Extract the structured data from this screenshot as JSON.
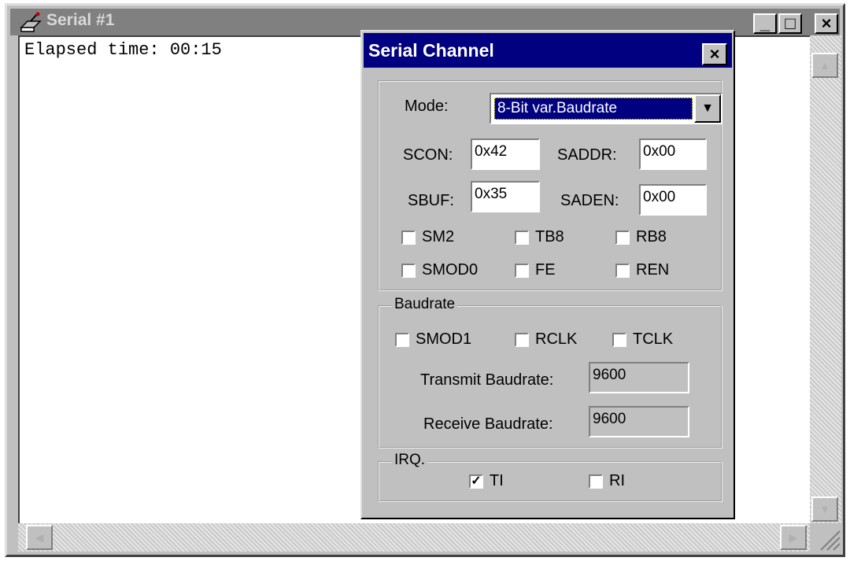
{
  "window": {
    "title": "Serial #1",
    "minimize_glyph": "_",
    "maximize_glyph": "□",
    "close_glyph": "×",
    "content_text": "Elapsed time: 00:15"
  },
  "dialog": {
    "title": "Serial Channel",
    "close_glyph": "×",
    "mode_label": "Mode:",
    "mode_value": "8-Bit var.Baudrate",
    "scon_label": "SCON:",
    "scon_value": "0x42",
    "saddr_label": "SADDR:",
    "saddr_value": "0x00",
    "sbuf_label": "SBUF:",
    "sbuf_value": "0x35",
    "saden_label": "SADEN:",
    "saden_value": "0x00",
    "flags": [
      {
        "label": "SM2",
        "checked": false
      },
      {
        "label": "TB8",
        "checked": false
      },
      {
        "label": "RB8",
        "checked": false
      },
      {
        "label": "SMOD0",
        "checked": false
      },
      {
        "label": "FE",
        "checked": false
      },
      {
        "label": "REN",
        "checked": false
      }
    ],
    "baudrate": {
      "group_label": "Baudrate",
      "flags": [
        {
          "label": "SMOD1",
          "checked": false
        },
        {
          "label": "RCLK",
          "checked": false
        },
        {
          "label": "TCLK",
          "checked": false
        }
      ],
      "transmit_label": "Transmit Baudrate:",
      "transmit_value": "9600",
      "receive_label": "Receive Baudrate:",
      "receive_value": "9600"
    },
    "irq": {
      "group_label": "IRQ.",
      "flags": [
        {
          "label": "TI",
          "checked": true
        },
        {
          "label": "RI",
          "checked": false
        }
      ]
    }
  },
  "icons": {
    "window_icon": "serial-port-icon",
    "combo_arrow": "chevron-down-icon",
    "scroll_up": "arrow-up-icon",
    "scroll_down": "arrow-down-icon",
    "scroll_left": "arrow-left-icon",
    "scroll_right": "arrow-right-icon"
  },
  "colors": {
    "dialog_title_bg": "#000080",
    "inactive_title_bg": "#808080",
    "face": "#c0c0c0"
  }
}
